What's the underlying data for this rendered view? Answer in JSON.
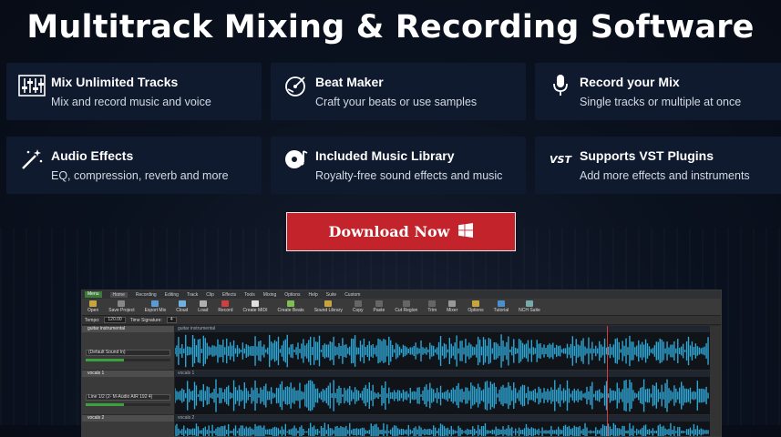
{
  "headline": "Multitrack Mixing & Recording Software",
  "features": [
    {
      "title": "Mix Unlimited Tracks",
      "desc": "Mix and record music and voice",
      "icon": "mixer-icon"
    },
    {
      "title": "Beat Maker",
      "desc": "Craft your beats or use samples",
      "icon": "turntable-icon"
    },
    {
      "title": "Record your Mix",
      "desc": "Single tracks or multiple at once",
      "icon": "microphone-icon"
    },
    {
      "title": "Audio Effects",
      "desc": "EQ, compression, reverb and more",
      "icon": "magic-wand-icon"
    },
    {
      "title": "Included Music Library",
      "desc": "Royalty-free sound effects and music",
      "icon": "music-disc-icon"
    },
    {
      "title": "Supports VST Plugins",
      "desc": "Add more effects and instruments",
      "icon": "vst-icon",
      "icon_text": "VST"
    }
  ],
  "download": {
    "label": "Download Now",
    "icon": "windows-icon",
    "color": "#c3242c"
  },
  "app": {
    "menu_button": "Menu",
    "tabs": [
      "Home",
      "Recording",
      "Editing",
      "Track",
      "Clip",
      "Effects",
      "Tools",
      "Mixing",
      "Options",
      "Help",
      "Suite",
      "Custom"
    ],
    "ribbon": [
      "Open",
      "Save Project",
      "Export Mix",
      "Cloud",
      "Load",
      "Record",
      "Create MIDI",
      "Create Beats",
      "Sound Library",
      "Copy",
      "Paste",
      "Cut Region",
      "Trim",
      "Mixer",
      "Options",
      "Tutorial",
      "NCH Suite"
    ],
    "tempo_label": "Tempo:",
    "tempo_value": "120.00",
    "time_signature_label": "Time Signature:",
    "time_signature_value": "4",
    "tracks": [
      {
        "name": "guitar instrumental",
        "clip": "guitar instrumental",
        "input": "(Default Sound In)"
      },
      {
        "name": "vocals 1",
        "clip": "vocals 1",
        "input": "Line 1/2 (2- M-Audio AIR 192 4)"
      },
      {
        "name": "vocals 2",
        "clip": "vocals 2",
        "input": ""
      }
    ],
    "accent_color": "#2fa8d8"
  }
}
